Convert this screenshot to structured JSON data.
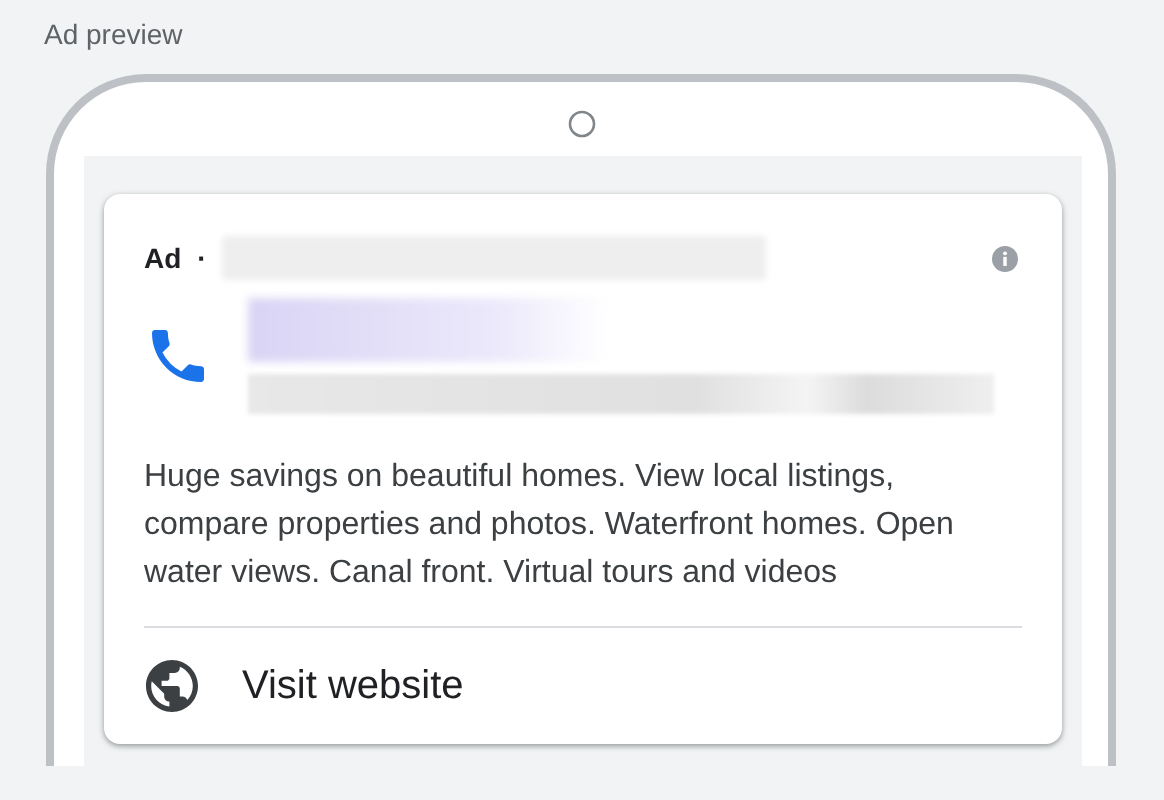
{
  "title": "Ad preview",
  "ad": {
    "label": "Ad",
    "separator": "·",
    "description": "Huge savings on beautiful homes. View local listings, compare properties and photos. Waterfront homes. Open water views. Canal front. Virtual tours and videos",
    "action": "Visit website"
  }
}
